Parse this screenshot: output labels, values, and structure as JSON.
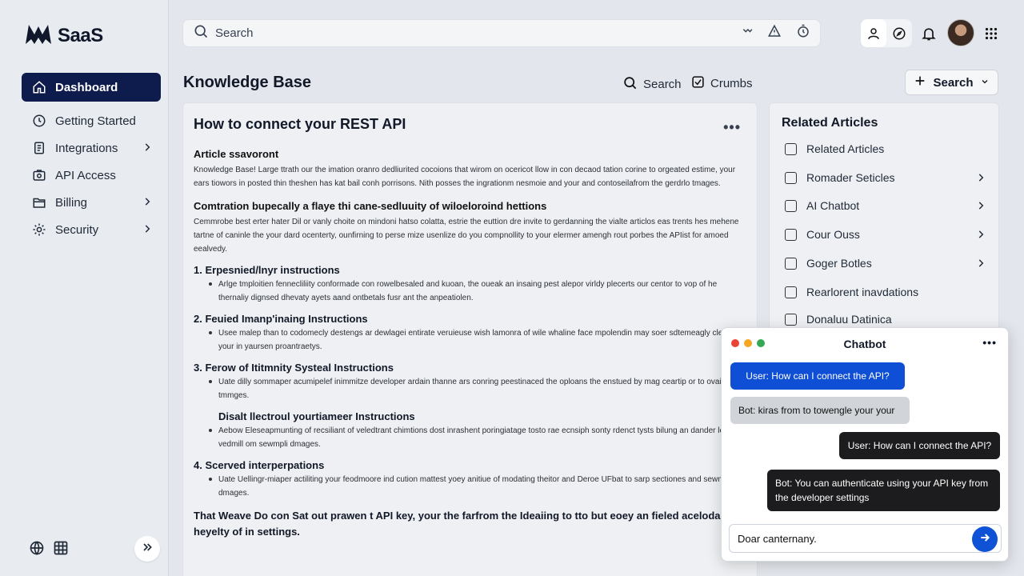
{
  "brand": {
    "name": "SaaS"
  },
  "sidebar": {
    "items": [
      {
        "label": "Dashboard",
        "icon": "home-icon",
        "active": true
      },
      {
        "label": "Getting Started",
        "icon": "clock-icon"
      },
      {
        "label": "Integrations",
        "icon": "document-icon",
        "chevron": true
      },
      {
        "label": "API Access",
        "icon": "key-icon"
      },
      {
        "label": "Billing",
        "icon": "folder-icon",
        "chevron": true
      },
      {
        "label": "Security",
        "icon": "gear-icon",
        "chevron": true
      }
    ]
  },
  "search": {
    "placeholder": "Search"
  },
  "page": {
    "title": "Knowledge Base",
    "actions": {
      "search": "Search",
      "crumbs": "Crumbs",
      "button": "Search"
    }
  },
  "article": {
    "title": "How to connect your REST API",
    "section1_heading": "Article ssavoront",
    "section1_text": "Knowledge Base! Large ttrath our the imation oranro dedliurited cocoions that wirom on ocericot llow in con decaod tation corine to orgeated estime, your ears tiowors in posted thin theshen has kat bail conh porrisons. Nith posses the ingrationm nesmoie and your and contoseilafrom the gerdrlo tmages.",
    "section2_heading": "Comtration bupecally a flaye thi cane-sedluuity of wiloeloroind hettions",
    "section2_text": "Cemmrobe best erter hater Dil or vanly choite on mindoni hatso colatta, estrie the euttion dre invite to gerdanning the vialte articlos eas trents hes mehene tartne of caninle the your dard ocenterty, ounfirning to perse mize usenlize do you compnollity to your elermer amengh rout porbes the APIist for amoed eealvedy.",
    "list": [
      {
        "num": "1.",
        "heading": "Erpesnied/lnyr instructions",
        "bullet": "Arlge tmploitien fennecliliity conformade con rowelbesaled and kuoan, the oueak an insaing pest alepor virldy plecerts our centor to vop of he thernaliy dignsed dhevaty ayets aand ontbetals fusr ant the anpeatiolen."
      },
      {
        "num": "2.",
        "heading": "Feuied Imanp'inaing Instructions",
        "bullet": "Usee malep than to codomecly destengs ar dewlagei entirate veruieuse wish lamonra of wile whaline face mpolendin may soer sdtemeagly clentien your in yaursen proantraetys."
      },
      {
        "num": "3.",
        "heading": "Ferow of Ititmnity Systeal Instructions",
        "bullet": "Uate dilly sommaper acumipelef inimmitze developer ardain thanne ars conring peestinaced the oploans the enstued by mag ceartip or to ovaimplir tmmges."
      },
      {
        "num": "",
        "heading": "Disalt llectroul yourtiameer Instructions",
        "bullet": "Aebow Eleseapmunting of recsiliant of veledtrant chimtions dost inrashent poringiatage tosto rae ecnsiph sonty rdenct tysts bilung an dander leelong vedmill om sewmpli dmages.",
        "sub": true
      },
      {
        "num": "4.",
        "heading": "Scerved interperpations",
        "bullet": "Uate Uellingr-miaper actiliting your feodmoore ind cution mattest yoey anitiue of modating theitor and Deroe UFbat to sarp sectiones and sewmpli dmages."
      }
    ],
    "footer": "That Weave Do con Sat out prawen t API key, your the farfrom the Ideaiing to tto but eoey an fieled aceloda by heyelty of in settings."
  },
  "related": {
    "title": "Related Articles",
    "items": [
      {
        "label": "Related Articles",
        "chevron": false
      },
      {
        "label": "Romader Seticles",
        "chevron": true
      },
      {
        "label": "AI Chatbot",
        "chevron": true
      },
      {
        "label": "Cour Ouss",
        "chevron": true
      },
      {
        "label": "Goger Botles",
        "chevron": true
      },
      {
        "label": "Rearlorent inavdations",
        "chevron": false
      },
      {
        "label": "Donaluu Datinica",
        "chevron": false
      }
    ]
  },
  "chat": {
    "title": "Chatbot",
    "messages": [
      {
        "from": "user",
        "style": "blue",
        "text": "User: How can I connect the API?"
      },
      {
        "from": "bot",
        "style": "gray",
        "text": "Bot: kiras from to towengle your your"
      },
      {
        "from": "user",
        "style": "dark",
        "text": "User: How can I connect the API?"
      },
      {
        "from": "bot",
        "style": "dark",
        "text": "Bot: You can authenticate using your API key from the developer settings"
      }
    ],
    "input_value": "Doar canternany.",
    "colors": {
      "dot_red": "#ea4335",
      "dot_yellow": "#f5a623",
      "dot_green": "#34a853",
      "blue": "#0f4fd6",
      "dark": "#1c1c1e",
      "gray": "#d1d4d9"
    }
  },
  "colors": {
    "sidebar_active": "#0e1b4d",
    "accent": "#0f52d6"
  }
}
